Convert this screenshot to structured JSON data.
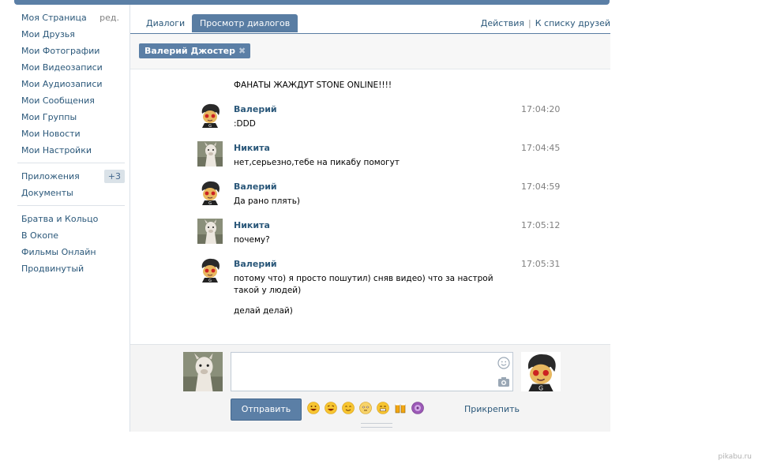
{
  "left_menu": {
    "main_items": [
      "Моя Страница",
      "Мои Друзья",
      "Мои Фотографии",
      "Мои Видеозаписи",
      "Мои Аудиозаписи",
      "Мои Сообщения",
      "Мои Группы",
      "Мои Новости",
      "Мои Настройки"
    ],
    "edit_label": "ред.",
    "apps_label": "Приложения",
    "apps_badge": "+3",
    "docs_label": "Документы",
    "app_links": [
      "Братва и Кольцо",
      "В Окопе",
      "Фильмы Онлайн",
      "Продвинутый"
    ]
  },
  "tabs": {
    "dialogs": "Диалоги",
    "view_dialogs": "Просмотр диалогов"
  },
  "actions": {
    "actions_label": "Действия",
    "separator": "|",
    "friends_list_label": "К списку друзей"
  },
  "peer": {
    "name": "Валерий Джостер",
    "remove": "✖"
  },
  "messages": [
    {
      "author": "",
      "time": "",
      "lines": [
        "ФАНАТЫ ЖАЖДУТ STONE ONLINE!!!!"
      ],
      "avatar": "valery"
    },
    {
      "author": "Валерий",
      "time": "17:04:20",
      "lines": [
        ":DDD"
      ],
      "avatar": "valery"
    },
    {
      "author": "Никита",
      "time": "17:04:45",
      "lines": [
        "нет,серьезно,тебе на пикабу помогут"
      ],
      "avatar": "nikita"
    },
    {
      "author": "Валерий",
      "time": "17:04:59",
      "lines": [
        "Да рано плять)"
      ],
      "avatar": "valery"
    },
    {
      "author": "Никита",
      "time": "17:05:12",
      "lines": [
        "почему?"
      ],
      "avatar": "nikita"
    },
    {
      "author": "Валерий",
      "time": "17:05:31",
      "lines": [
        "потому что) я просто пошутил) сняв видео) что за настрой такой у людей)",
        "делай делай)"
      ],
      "avatar": "valery"
    }
  ],
  "composer": {
    "text_value": "",
    "send_label": "Отправить",
    "attach_label": "Прикрепить",
    "emoji_icons": [
      "grin-emoji",
      "laugh-emoji",
      "smile-emoji",
      "blush-emoji",
      "grimace-emoji",
      "beer-emoji",
      "purple-emoji"
    ]
  },
  "watermark": "pikabu.ru",
  "colors": {
    "accent": "#5b7fa6",
    "link": "#2b587a",
    "time": "#808080",
    "composer_bg": "#f4f4f4"
  }
}
